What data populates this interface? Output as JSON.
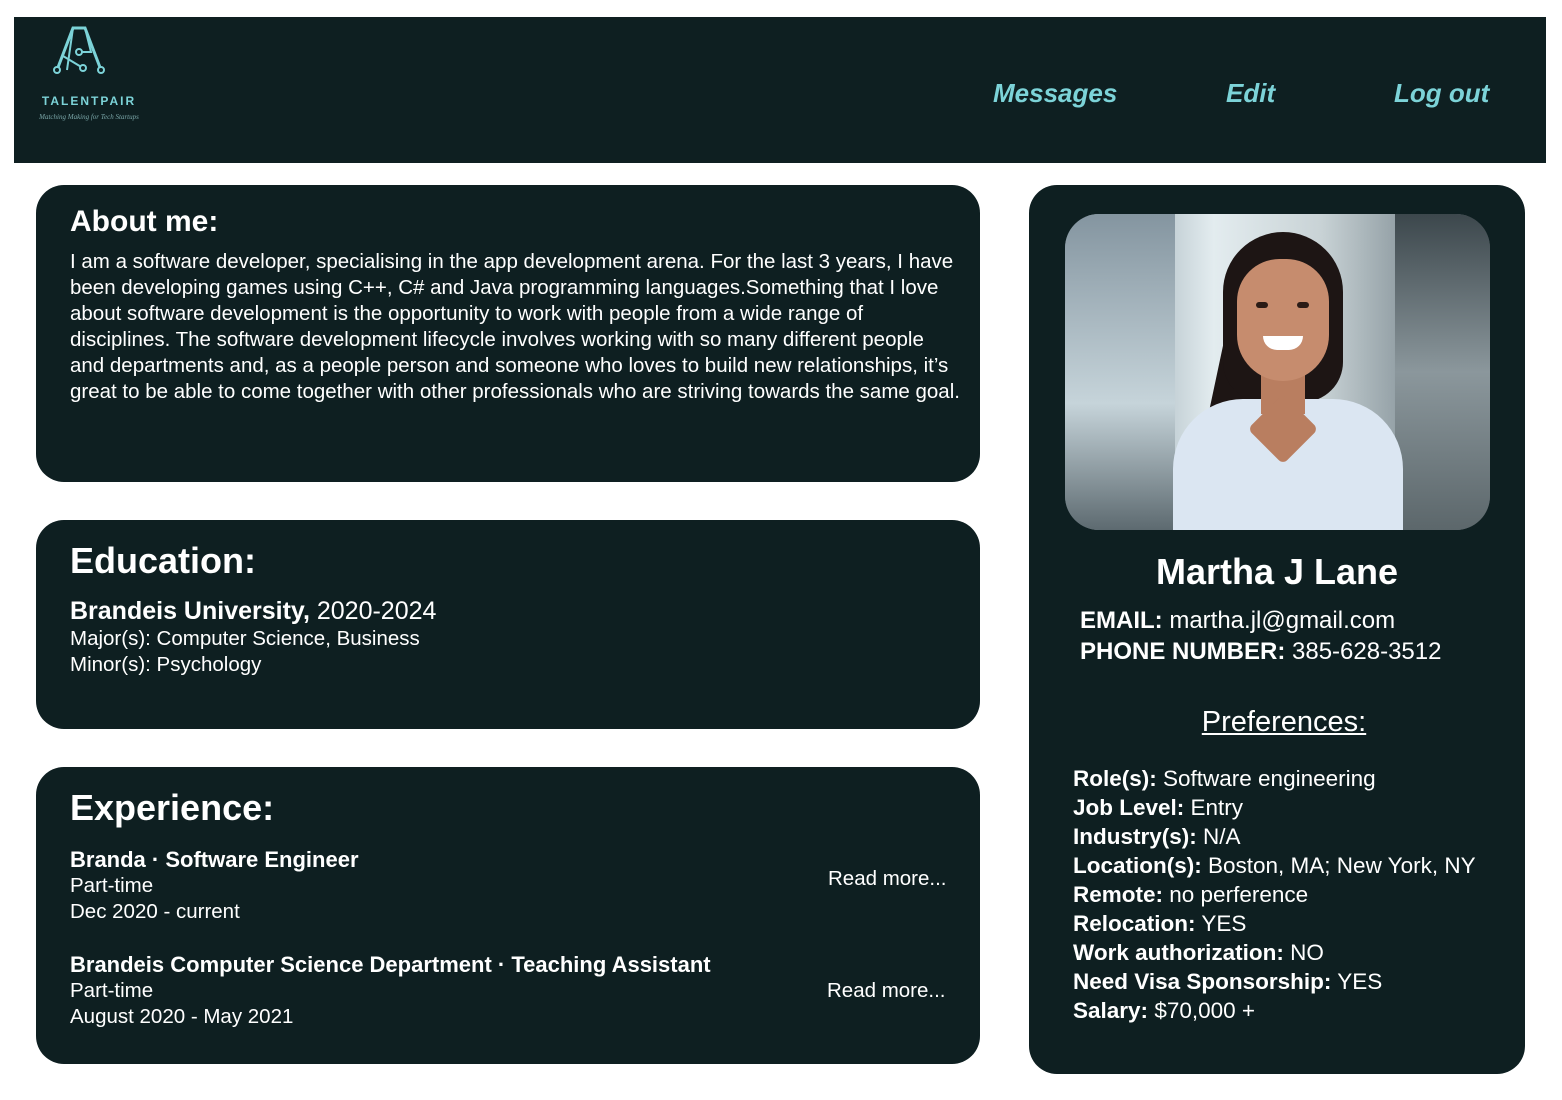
{
  "brand": {
    "name": "TALENTPAIR",
    "tagline": "Matching Making for Tech Startups",
    "logo_icon": "ai-circuit-logo-icon",
    "accent_color": "#7cd3d8"
  },
  "nav": {
    "messages": "Messages",
    "edit": "Edit",
    "logout": "Log out"
  },
  "about": {
    "title": "About me:",
    "text": "I am a software developer, specialising in the app development arena. For the last 3 years, I have been developing games using C++, C# and Java programming languages.Something that I love about software development is the opportunity to work with people from a wide range of disciplines. The software development lifecycle involves working with so many different people and departments and, as a people person and someone who loves to build new relationships, it’s great to be able to come together with other professionals who are striving towards the same goal."
  },
  "education": {
    "title": "Education:",
    "school": "Brandeis University,",
    "years": " 2020-2024",
    "major": "Major(s): Computer Science, Business",
    "minor": "Minor(s): Psychology"
  },
  "experience": {
    "title": "Experience:",
    "items": [
      {
        "title": "Branda · Software Engineer",
        "type": "Part-time",
        "dates": "Dec 2020 - current",
        "read_more": "Read more..."
      },
      {
        "title": "Brandeis Computer Science Department · Teaching Assistant",
        "type": "Part-time",
        "dates": "August 2020 - May 2021",
        "read_more": "Read more..."
      }
    ]
  },
  "profile": {
    "photo": "profile-photo",
    "name": "Martha J Lane",
    "email_label": "EMAIL:",
    "email": " martha.jl@gmail.com",
    "phone_label": "PHONE NUMBER:",
    "phone": " 385-628-3512"
  },
  "preferences": {
    "title": "Preferences:",
    "items": [
      {
        "label": "Role(s):",
        "value": " Software engineering"
      },
      {
        "label": "Job Level:",
        "value": " Entry"
      },
      {
        "label": "Industry(s):",
        "value": " N/A"
      },
      {
        "label": "Location(s):",
        "value": " Boston, MA; New York, NY"
      },
      {
        "label": "Remote:",
        "value": " no perference"
      },
      {
        "label": "Relocation:",
        "value": " YES"
      },
      {
        "label": "Work authorization:",
        "value": " NO"
      },
      {
        "label": "Need Visa Sponsorship:",
        "value": " YES"
      },
      {
        "label": "Salary:",
        "value": " $70,000 +"
      }
    ]
  }
}
